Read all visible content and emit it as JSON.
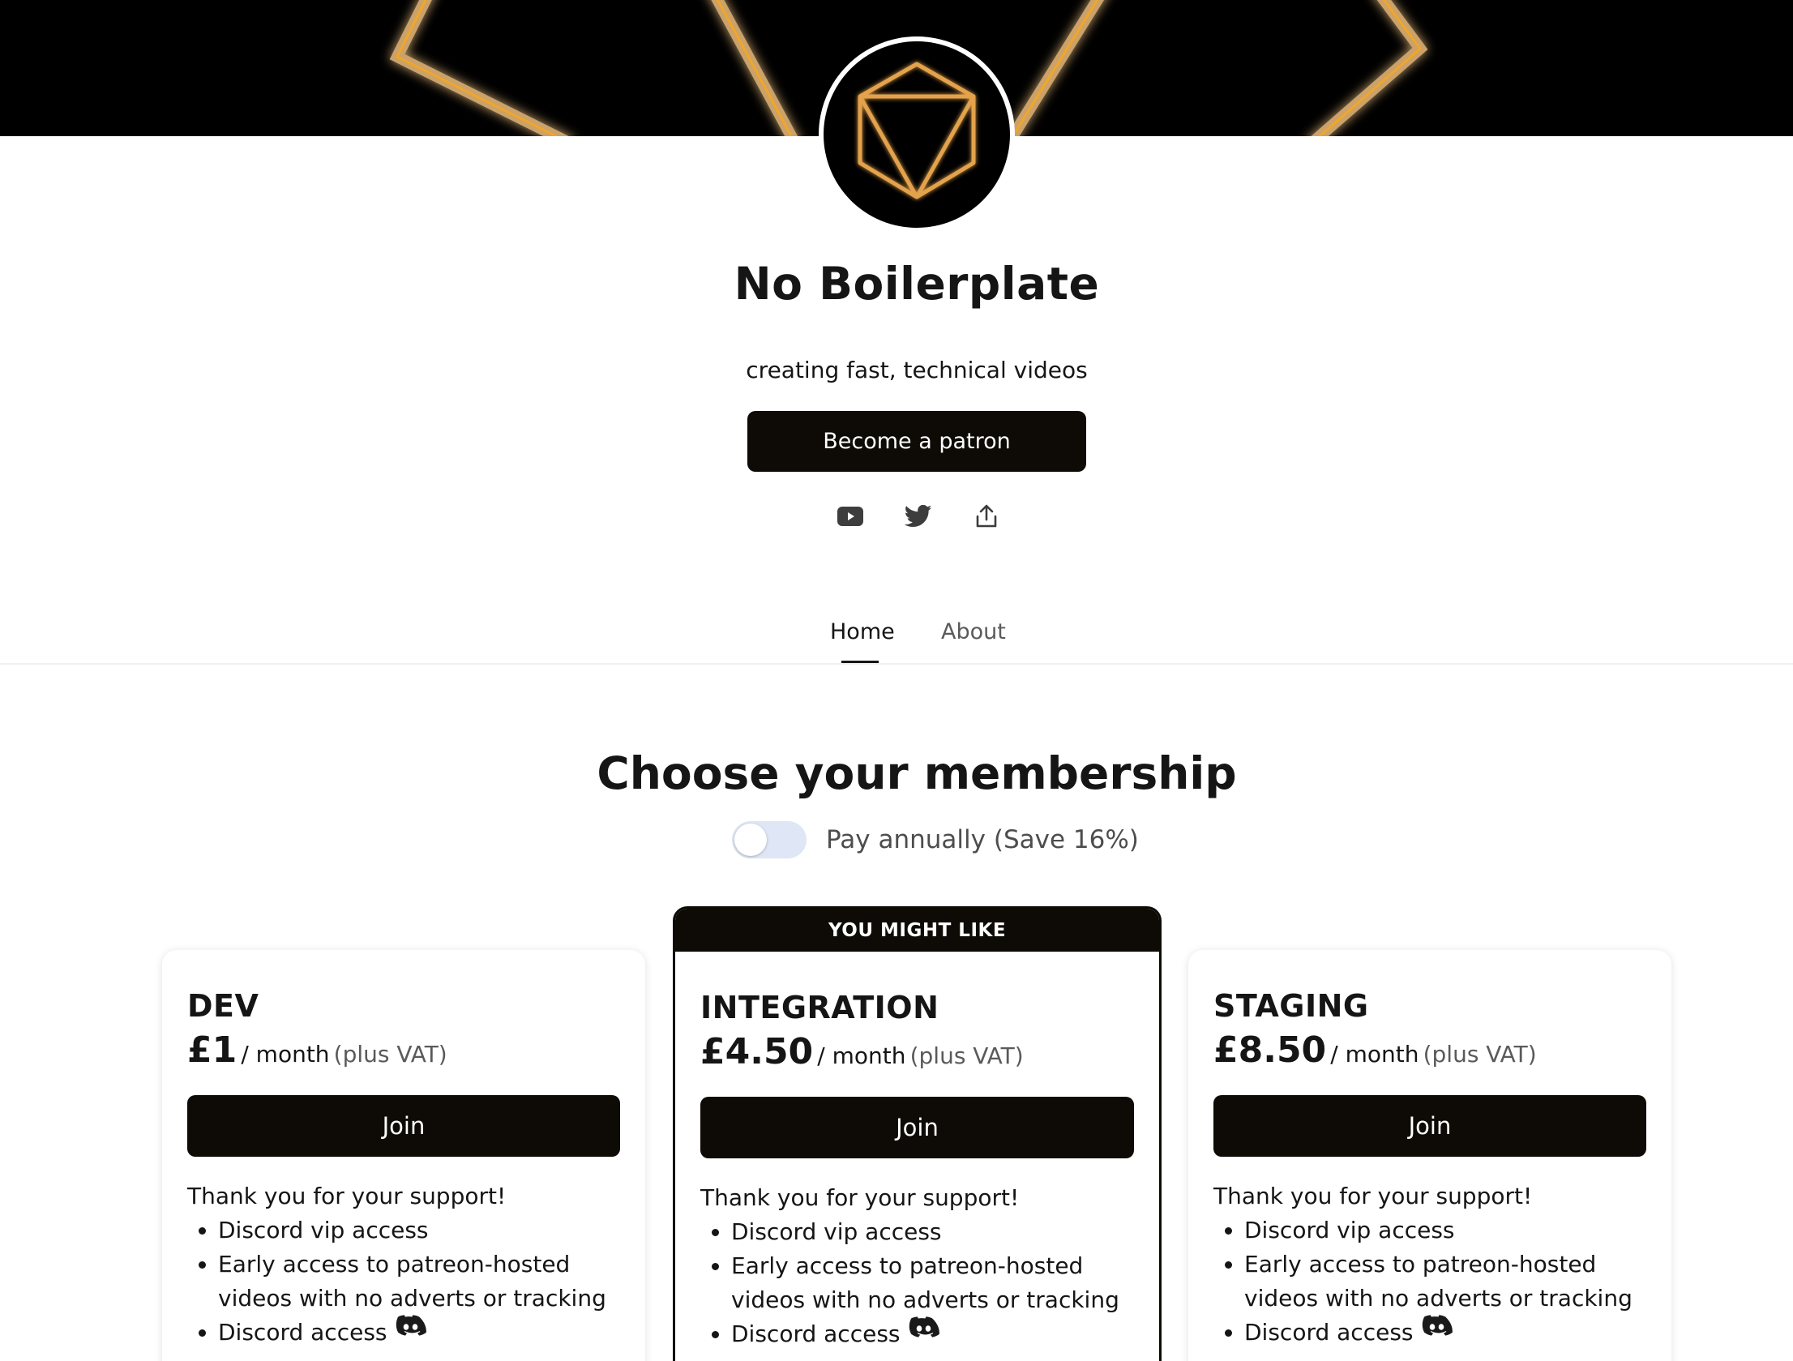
{
  "creator": {
    "name": "No Boilerplate",
    "tagline": "creating fast, technical videos",
    "cta_label": "Become a patron"
  },
  "social": {
    "icons": [
      "youtube-icon",
      "twitter-icon",
      "share-icon"
    ]
  },
  "tabs": [
    {
      "label": "Home",
      "active": true
    },
    {
      "label": "About",
      "active": false
    }
  ],
  "membership": {
    "title": "Choose your membership",
    "toggle_label": "Pay annually (Save 16%)",
    "toggle_on": false
  },
  "tiers": [
    {
      "name": "DEV",
      "price": "£1",
      "period": "/ month",
      "vat": "(plus VAT)",
      "join_label": "Join",
      "description": "Thank you for your support!",
      "benefits": [
        "Discord vip access",
        "Early access to patreon-hosted videos with no adverts or tracking",
        "Discord access"
      ]
    },
    {
      "name": "INTEGRATION",
      "price": "£4.50",
      "period": "/ month",
      "vat": "(plus VAT)",
      "join_label": "Join",
      "badge": "YOU MIGHT LIKE",
      "description": "Thank you for your support!",
      "benefits": [
        "Discord vip access",
        "Early access to patreon-hosted videos with no adverts or tracking",
        "Discord access"
      ]
    },
    {
      "name": "STAGING",
      "price": "£8.50",
      "period": "/ month",
      "vat": "(plus VAT)",
      "join_label": "Join",
      "description": "Thank you for your support!",
      "benefits": [
        "Discord vip access",
        "Early access to patreon-hosted videos with no adverts or tracking",
        "Discord access"
      ]
    }
  ],
  "colors": {
    "accent_dark": "#0e0b07",
    "banner_glow": "#f5a623",
    "toggle_track": "#dfe6f5"
  }
}
